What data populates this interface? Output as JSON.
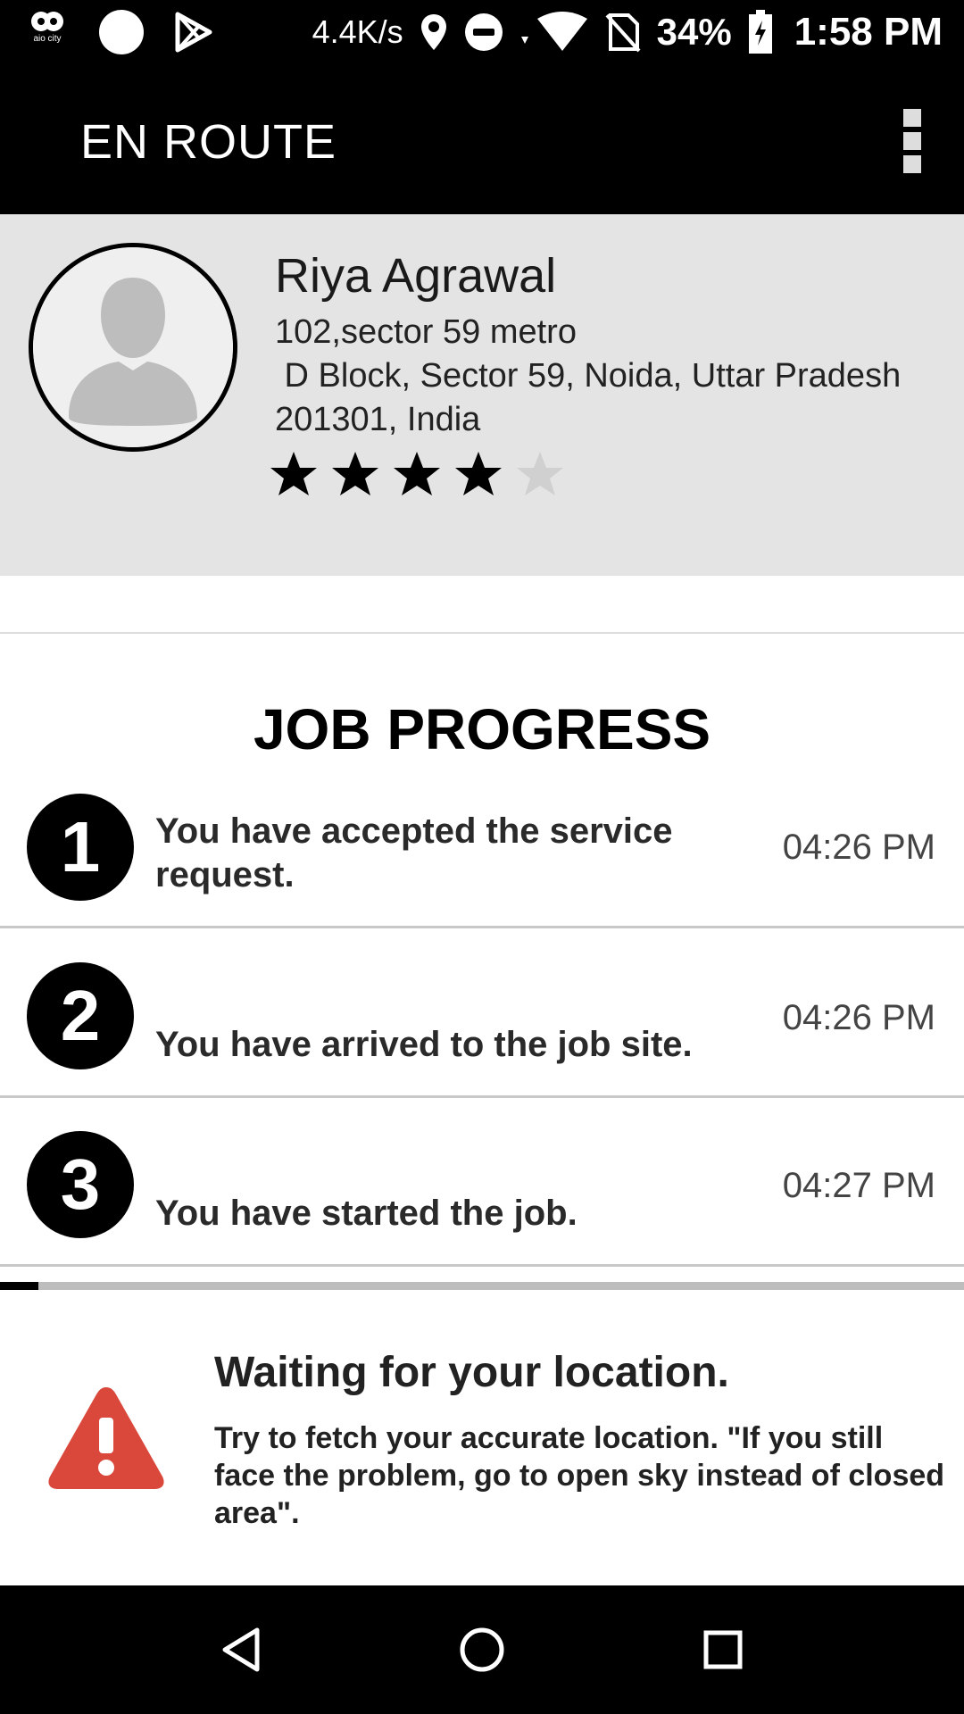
{
  "status_bar": {
    "net_speed": "4.4K/s",
    "battery": "34%",
    "time": "1:58 PM",
    "app_icon_text": "aio city",
    "icons": [
      "aio-app-icon",
      "circle-notification-icon",
      "play-store-icon",
      "location-icon",
      "do-not-disturb-icon",
      "wifi-icon",
      "no-sim-icon",
      "battery-charging-icon"
    ]
  },
  "app_bar": {
    "title": "EN ROUTE",
    "menu_icon": "overflow-menu-icon"
  },
  "client": {
    "name": "Riya Agrawal",
    "address_lines": [
      "102,sector 59 metro",
      " D Block, Sector 59, Noida, Uttar Pradesh",
      "201301, India"
    ],
    "rating": 4,
    "rating_max": 5,
    "avatar_icon": "person-placeholder-icon"
  },
  "job_progress": {
    "title": "JOB PROGRESS",
    "steps": [
      {
        "number": "1",
        "text": "You have accepted the service request.",
        "time": "04:26 PM"
      },
      {
        "number": "2",
        "text": "You have arrived to the job site.",
        "time": "04:26 PM"
      },
      {
        "number": "3",
        "text": "You have started the job.",
        "time": "04:27 PM"
      }
    ],
    "loading_progress": 0.04
  },
  "location_warning": {
    "icon": "warning-icon",
    "title": "Waiting for your location.",
    "message": "Try to fetch  your accurate location. \"If you still face the problem, go to open sky instead of closed area\".",
    "icon_color": "#d9483b"
  },
  "nav_bar": {
    "icons": [
      "back-icon",
      "home-icon",
      "recents-icon"
    ]
  }
}
